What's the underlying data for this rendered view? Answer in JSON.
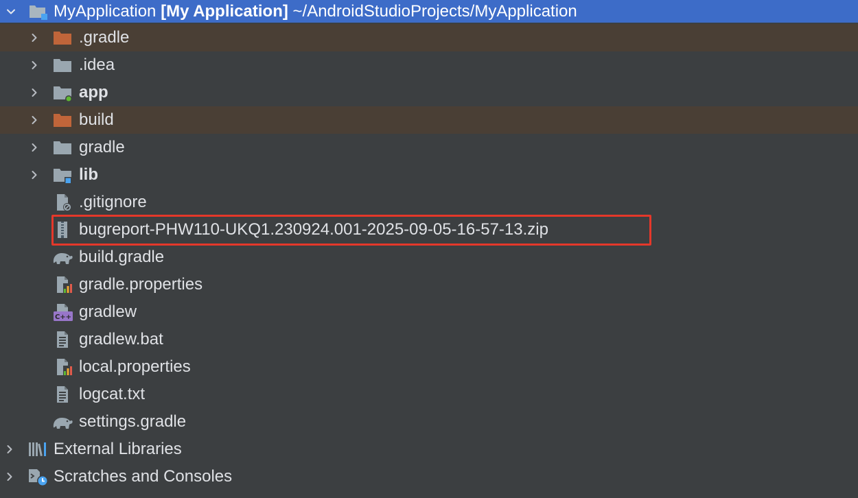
{
  "root": {
    "name": "MyApplication",
    "module": "[My Application]",
    "path": "~/AndroidStudioProjects/MyApplication"
  },
  "items": [
    {
      "label": ".gradle",
      "icon": "folder-excluded-icon"
    },
    {
      "label": ".idea",
      "icon": "folder-icon"
    },
    {
      "label": "app",
      "icon": "module-folder-icon"
    },
    {
      "label": "build",
      "icon": "folder-excluded-icon"
    },
    {
      "label": "gradle",
      "icon": "folder-icon"
    },
    {
      "label": "lib",
      "icon": "library-module-icon"
    },
    {
      "label": ".gitignore",
      "icon": "ignore-file-icon"
    },
    {
      "label": "bugreport-PHW110-UKQ1.230924.001-2025-09-05-16-57-13.zip",
      "icon": "zip-archive-icon"
    },
    {
      "label": "build.gradle",
      "icon": "gradle-elephant-icon"
    },
    {
      "label": "gradle.properties",
      "icon": "properties-file-icon"
    },
    {
      "label": "gradlew",
      "icon": "script-file-icon"
    },
    {
      "label": "gradlew.bat",
      "icon": "text-file-icon"
    },
    {
      "label": "local.properties",
      "icon": "properties-file-icon"
    },
    {
      "label": "logcat.txt",
      "icon": "text-file-icon"
    },
    {
      "label": "settings.gradle",
      "icon": "gradle-elephant-icon"
    }
  ],
  "bottom_nodes": [
    {
      "label": "External Libraries",
      "icon": "libraries-icon"
    },
    {
      "label": "Scratches and Consoles",
      "icon": "scratches-icon"
    }
  ],
  "colors": {
    "background": "#3c3f41",
    "selection": "#3d6cc8",
    "excluded_row": "#4a3f35",
    "excluded_folder": "#c0653a",
    "folder": "#9aa7b0",
    "highlight": "#e5382a"
  }
}
